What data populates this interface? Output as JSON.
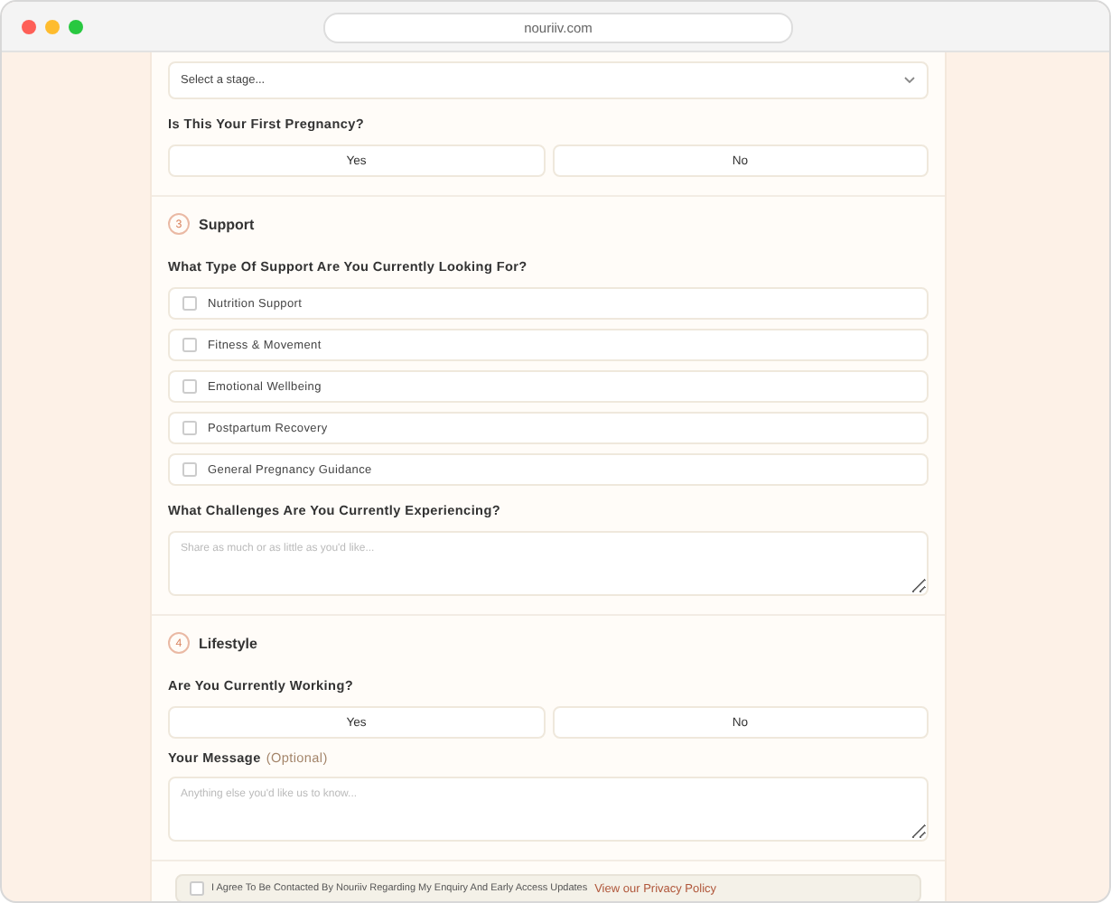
{
  "browser": {
    "url": "nouriiv.com"
  },
  "stage_select": {
    "placeholder": "Select a stage..."
  },
  "first_pregnancy": {
    "question": "Is This Your First Pregnancy?",
    "options": [
      {
        "label": "Yes",
        "selected": false
      },
      {
        "label": "No",
        "selected": false
      }
    ]
  },
  "support": {
    "number": "3",
    "title": "Support",
    "question": "What Type Of Support Are You Currently Looking For?",
    "options": [
      {
        "label": "Nutrition Support",
        "checked": false
      },
      {
        "label": "Fitness & Movement",
        "checked": false
      },
      {
        "label": "Emotional Wellbeing",
        "checked": false
      },
      {
        "label": "Postpartum Recovery",
        "checked": false
      },
      {
        "label": "General Pregnancy Guidance",
        "checked": false
      }
    ],
    "challenges_question": "What Challenges Are You Currently Experiencing?",
    "challenges_placeholder": "Share as much or as little as you'd like..."
  },
  "lifestyle": {
    "number": "4",
    "title": "Lifestyle",
    "question": "Are You Currently Working?",
    "options": [
      {
        "label": "Yes",
        "selected": false
      },
      {
        "label": "No",
        "selected": false
      }
    ],
    "message_label": "Your Message",
    "message_optional": "(Optional)",
    "message_placeholder": "Anything else you'd like us to know..."
  },
  "consent": {
    "checked": false,
    "text": "I Agree To Be Contacted By Nouriiv Regarding My Enquiry And Early Access Updates",
    "link": "View our Privacy Policy"
  }
}
